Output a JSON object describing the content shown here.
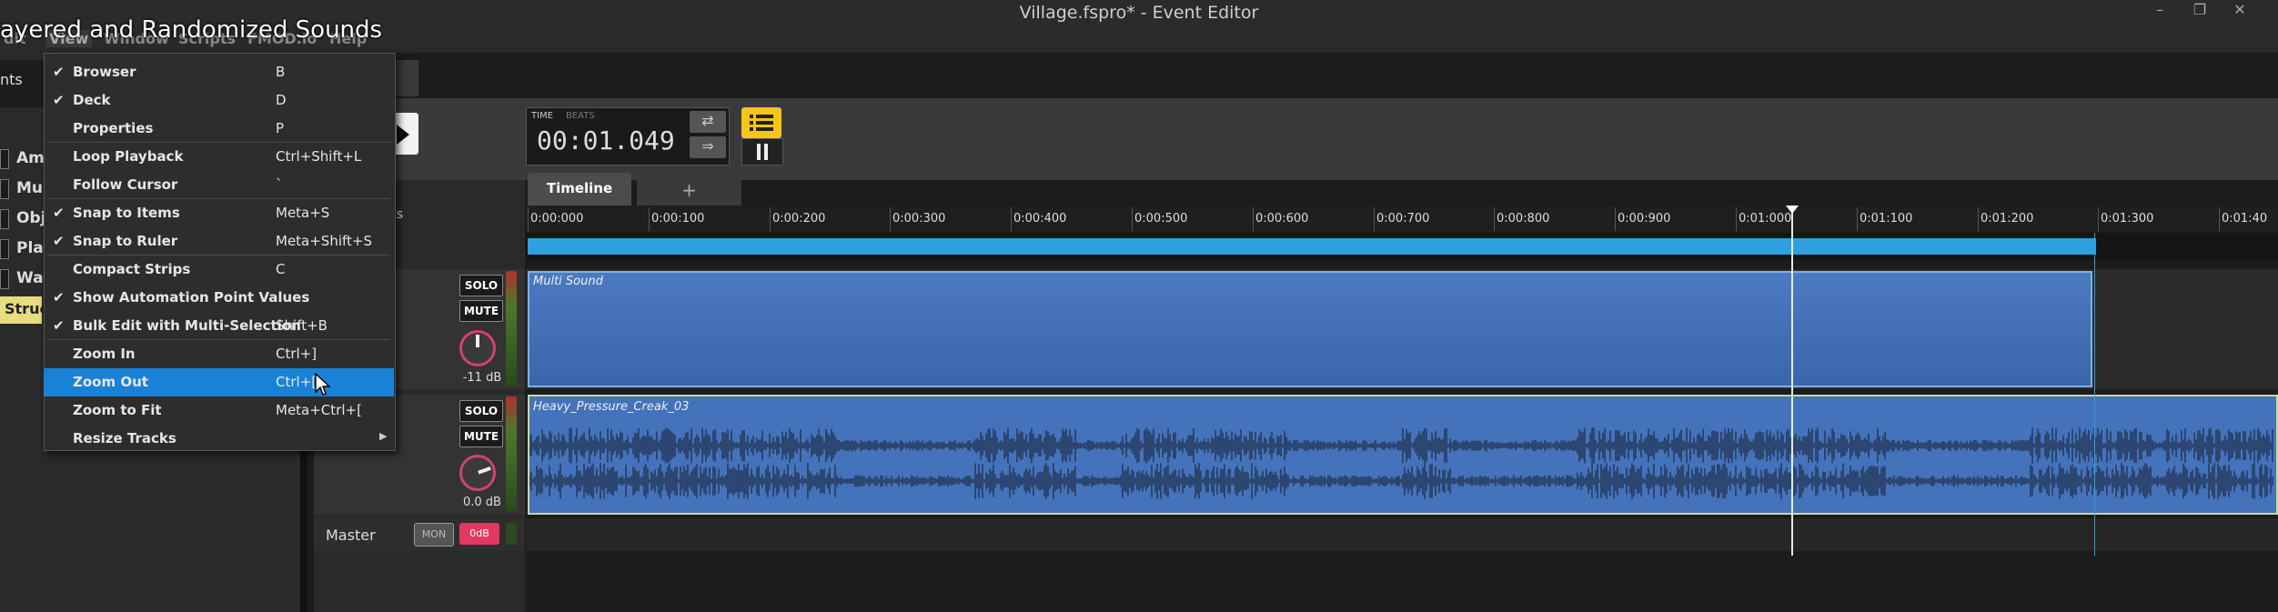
{
  "window": {
    "title": "Village.fspro* - Event Editor",
    "video_title": "ayered and Randomized Sounds",
    "buttons": [
      "–",
      "❐",
      "✕"
    ]
  },
  "menubar": {
    "items": [
      "dit",
      "View",
      "Window",
      "Scripts",
      "FMOD.io",
      "Help"
    ]
  },
  "left_panel": {
    "tab_label": "nts",
    "tree_items": [
      "Am",
      "Mu",
      "Obj",
      "Play",
      "Wat"
    ],
    "structure_label": "Struc"
  },
  "view_menu": {
    "items": [
      {
        "label": "Browser",
        "shortcut": "B",
        "checked": true
      },
      {
        "label": "Deck",
        "shortcut": "D",
        "checked": true
      },
      {
        "label": "Properties",
        "shortcut": "P",
        "checked": false
      },
      {
        "label": "Loop Playback",
        "shortcut": "Ctrl+Shift+L",
        "checked": false
      },
      {
        "label": "Follow Cursor",
        "shortcut": "`",
        "checked": false
      },
      {
        "label": "Snap to Items",
        "shortcut": "Meta+S",
        "checked": true
      },
      {
        "label": "Snap to Ruler",
        "shortcut": "Meta+Shift+S",
        "checked": true
      },
      {
        "label": "Compact Strips",
        "shortcut": "C",
        "checked": false
      },
      {
        "label": "Show Automation Point Values",
        "shortcut": "",
        "checked": true
      },
      {
        "label": "Bulk Edit with Multi-Selection",
        "shortcut": "Shift+B",
        "checked": true
      },
      {
        "label": "Zoom In",
        "shortcut": "Ctrl+]",
        "checked": false
      },
      {
        "label": "Zoom Out",
        "shortcut": "Ctrl+[",
        "checked": false,
        "highlighted": true
      },
      {
        "label": "Zoom to Fit",
        "shortcut": "Meta+Ctrl+[",
        "checked": false
      },
      {
        "label": "Resize Tracks",
        "shortcut": "",
        "checked": false,
        "submenu": true
      }
    ],
    "check_glyph": "✔",
    "submenu_glyph": "▶"
  },
  "transport": {
    "time_label": "TIME",
    "beats_label": "BEATS",
    "time_value": "00:01.049",
    "btn_up": "⇄",
    "btn_down": "⇒"
  },
  "tracks": {
    "header_label": "cks",
    "solo_label": "SOLO",
    "mute_label": "MUTE",
    "track1_gain": "-11 dB",
    "track2_gain": "0.0 dB",
    "master_label": "Master",
    "mon_label": "MON",
    "master_gain": "0dB"
  },
  "timeline": {
    "tab_label": "Timeline",
    "add_tab_label": "+",
    "ruler_ticks": [
      "0:00:000",
      "0:00:100",
      "0:00:200",
      "0:00:300",
      "0:00:400",
      "0:00:500",
      "0:00:600",
      "0:00:700",
      "0:00:800",
      "0:00:900",
      "0:01:000",
      "0:01:100",
      "0:01:200",
      "0:01:300",
      "0:01:40"
    ],
    "multi_clip_label": "Multi Sound",
    "audio_clip_label": "Heavy_Pressure_Creak_03"
  },
  "colors": {
    "accent": "#1a82d6",
    "loop_region": "#2ea0e0",
    "clip": "#4473bb",
    "loop_button": "#f5c518",
    "structure_highlight": "#e6dc82"
  }
}
